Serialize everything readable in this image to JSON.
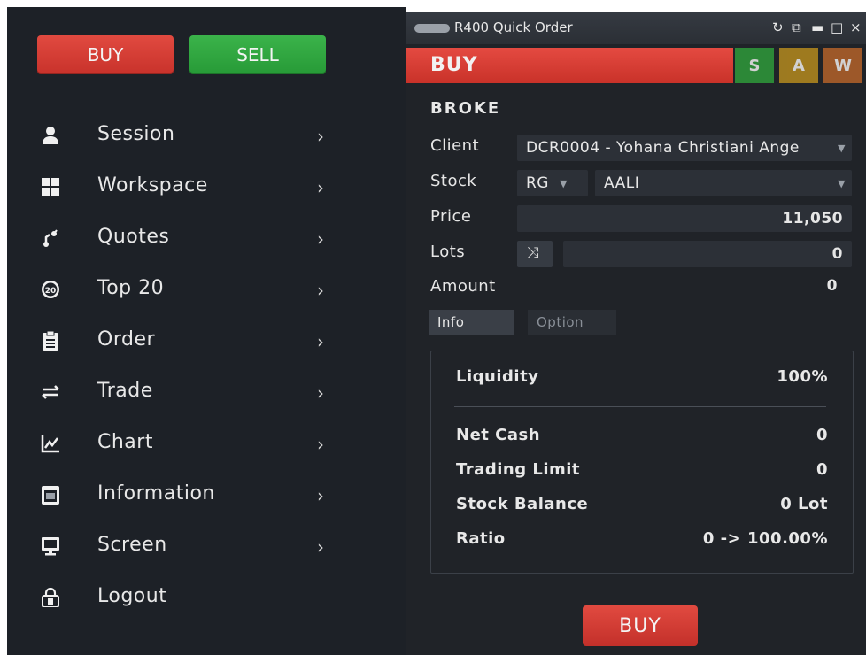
{
  "sidebar": {
    "buy_label": "BUY",
    "sell_label": "SELL",
    "items": [
      {
        "label": "Session",
        "icon": "user-icon",
        "glyph": "👤"
      },
      {
        "label": "Workspace",
        "icon": "grid-icon",
        "glyph": "▦"
      },
      {
        "label": "Quotes",
        "icon": "quotes-icon",
        "glyph": "❛"
      },
      {
        "label": "Top 20",
        "icon": "top20-icon",
        "glyph": "⓴"
      },
      {
        "label": "Order",
        "icon": "clipboard-icon",
        "glyph": "▤"
      },
      {
        "label": "Trade",
        "icon": "exchange-icon",
        "glyph": "⇌"
      },
      {
        "label": "Chart",
        "icon": "line-chart-icon",
        "glyph": "📈"
      },
      {
        "label": "Information",
        "icon": "calendar-icon",
        "glyph": "▣"
      },
      {
        "label": "Screen",
        "icon": "monitor-icon",
        "glyph": "🖵"
      },
      {
        "label": "Logout",
        "icon": "lock-icon",
        "glyph": "🔓"
      }
    ],
    "arrow": "›"
  },
  "panel": {
    "title": "R400 Quick Order",
    "controls": {
      "refresh": "↻",
      "popout": "⧉",
      "minimize": "▬",
      "maximize": "□",
      "close": "×"
    },
    "side_label": "BUY",
    "side_tabs": {
      "s": "S",
      "a": "A",
      "w": "W"
    },
    "heading": "BROKE",
    "client": {
      "label": "Client",
      "value": "DCR0004 - Yohana Christiani Ange"
    },
    "stock": {
      "label": "Stock",
      "board": "RG",
      "code": "AALI"
    },
    "price": {
      "label": "Price",
      "value": "11,050"
    },
    "lots": {
      "label": "Lots",
      "value": "0",
      "shuffle_glyph": "⤨"
    },
    "amount": {
      "label": "Amount",
      "value": "0"
    },
    "tabs": {
      "info": "Info",
      "option": "Option"
    },
    "info": {
      "liquidity_label": "Liquidity",
      "liquidity_value": "100%",
      "net_cash_label": "Net Cash",
      "net_cash_value": "0",
      "trading_limit_label": "Trading Limit",
      "trading_limit_value": "0",
      "stock_balance_label": "Stock Balance",
      "stock_balance_value": "0 Lot",
      "ratio_label": "Ratio",
      "ratio_value": "0 -> 100.00%"
    },
    "submit_label": "BUY"
  },
  "colors": {
    "buy": "#d63a32",
    "sell": "#2fa43e",
    "panel_bg": "#202328",
    "sidebar_bg": "#1d2127"
  }
}
